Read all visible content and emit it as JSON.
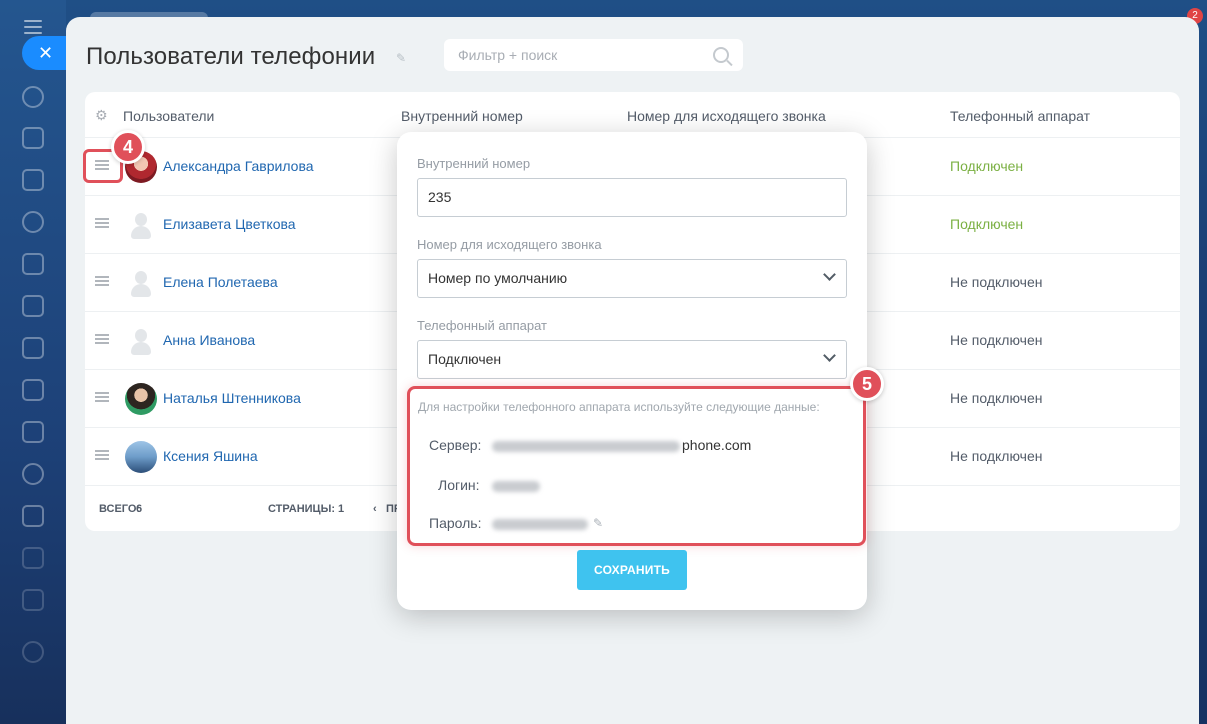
{
  "notifications": {
    "count": "2"
  },
  "page": {
    "title": "Пользователи телефонии",
    "filter_placeholder": "Фильтр + поиск"
  },
  "grid": {
    "columns": {
      "users": "Пользователи",
      "internal": "Внутренний номер",
      "outgoing": "Номер для исходящего звонка",
      "device": "Телефонный аппарат"
    },
    "rows": [
      {
        "name": "Александра Гаврилова",
        "status": "Подключен"
      },
      {
        "name": "Елизавета Цветкова",
        "status": "Подключен"
      },
      {
        "name": "Елена Полетаева",
        "status": "Не подключен"
      },
      {
        "name": "Анна Иванова",
        "status": "Не подключен"
      },
      {
        "name": "Наталья Штенникова",
        "status": "Не подключен"
      },
      {
        "name": "Ксения Яшина",
        "status": "Не подключен"
      }
    ],
    "footer": {
      "total_label": "ВСЕГО:",
      "total_value": "6",
      "pages_label": "СТРАНИЦЫ:",
      "pages_value": "1",
      "prev_label": "ПР"
    }
  },
  "markers": {
    "step4": "4",
    "step5": "5"
  },
  "popup": {
    "internal_label": "Внутренний номер",
    "internal_value": "235",
    "outgoing_label": "Номер для исходящего звонка",
    "outgoing_value": "Номер по умолчанию",
    "device_label": "Телефонный аппарат",
    "device_value": "Подключен",
    "hint": "Для настройки телефонного аппарата используйте следующие данные:",
    "server_label": "Сервер:",
    "server_value_visible": "phone.com",
    "login_label": "Логин:",
    "password_label": "Пароль:",
    "save_label": "СОХРАНИТЬ"
  }
}
